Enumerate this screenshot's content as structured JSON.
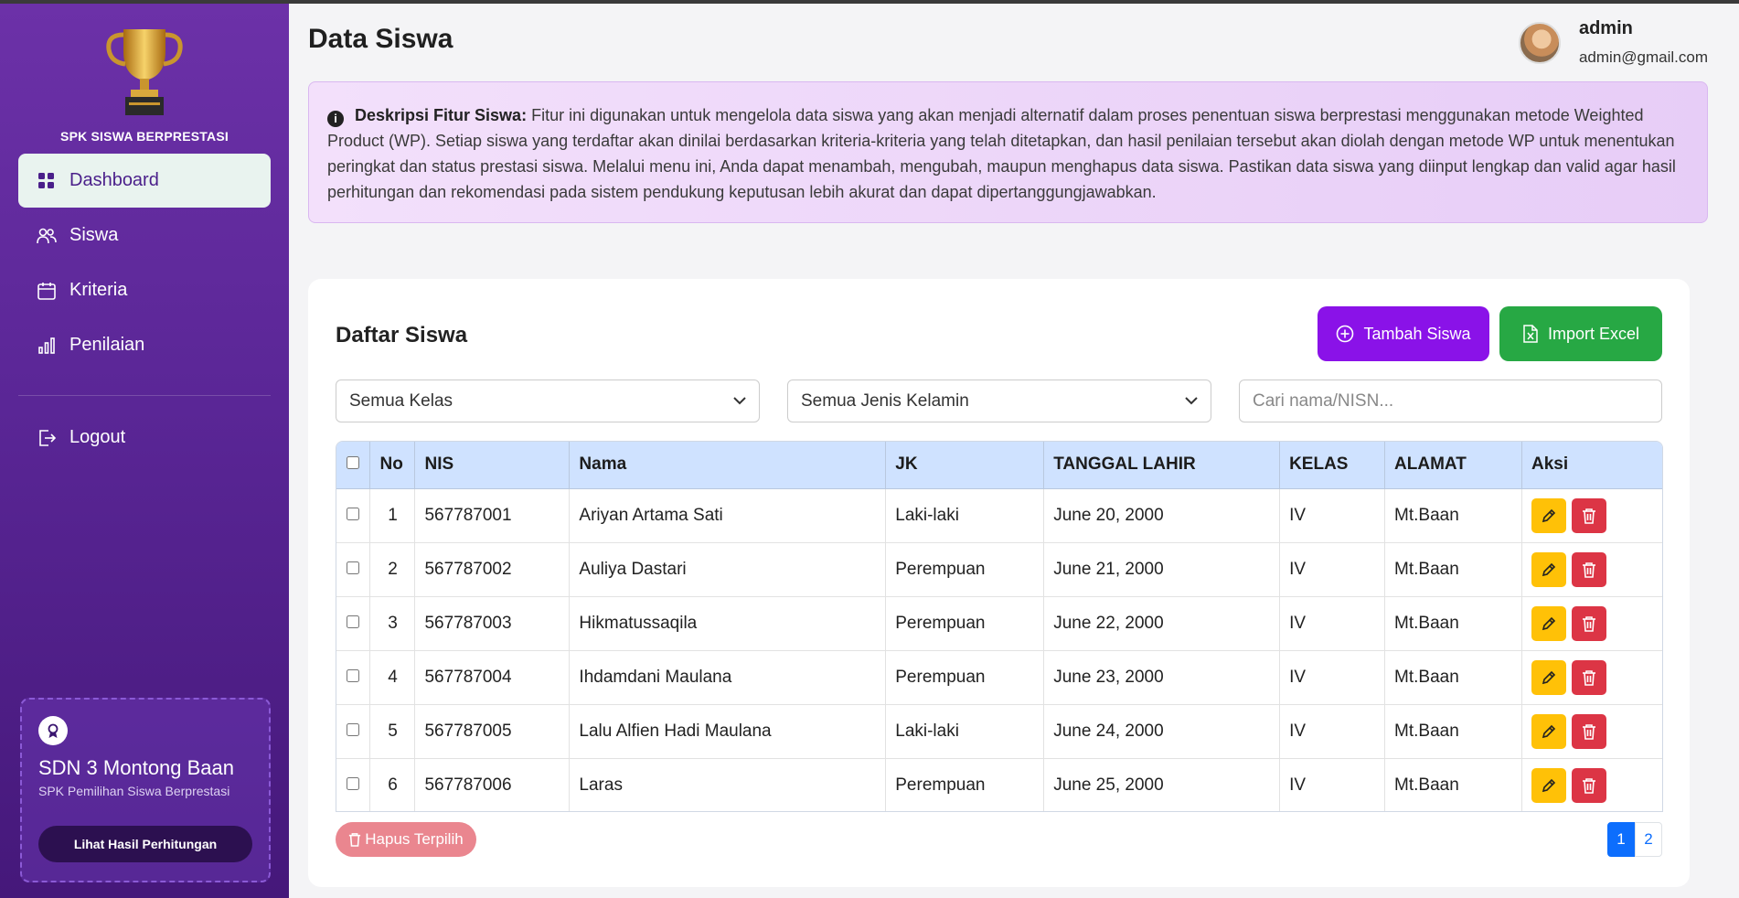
{
  "sidebar": {
    "brand": "SPK SISWA BERPRESTASI",
    "items": [
      {
        "label": "Dashboard"
      },
      {
        "label": "Siswa"
      },
      {
        "label": "Kriteria"
      },
      {
        "label": "Penilaian"
      },
      {
        "label": "Logout"
      }
    ],
    "school": {
      "name": "SDN 3 Montong Baan",
      "subtitle": "SPK Pemilihan Siswa Berprestasi",
      "button_label": "Lihat Hasil Perhitungan"
    }
  },
  "header": {
    "title": "Data Siswa",
    "user_name": "admin",
    "user_email": "admin@gmail.com"
  },
  "info": {
    "label": "Deskripsi Fitur Siswa:",
    "text": "Fitur ini digunakan untuk mengelola data siswa yang akan menjadi alternatif dalam proses penentuan siswa berprestasi menggunakan metode Weighted Product (WP). Setiap siswa yang terdaftar akan dinilai berdasarkan kriteria-kriteria yang telah ditetapkan, dan hasil penilaian tersebut akan diolah dengan metode WP untuk menentukan peringkat dan status prestasi siswa. Melalui menu ini, Anda dapat menambah, mengubah, maupun menghapus data siswa. Pastikan data siswa yang diinput lengkap dan valid agar hasil perhitungan dan rekomendasi pada sistem pendukung keputusan lebih akurat dan dapat dipertanggungjawabkan."
  },
  "card": {
    "title": "Daftar Siswa",
    "add_label": "Tambah Siswa",
    "import_label": "Import Excel",
    "filter_kelas": "Semua Kelas",
    "filter_jk": "Semua Jenis Kelamin",
    "search_placeholder": "Cari nama/NISN...",
    "bulk_delete_label": "Hapus Terpilih"
  },
  "table": {
    "headers": [
      "No",
      "NIS",
      "Nama",
      "JK",
      "TANGGAL LAHIR",
      "KELAS",
      "ALAMAT",
      "Aksi"
    ],
    "rows": [
      {
        "no": "1",
        "nis": "567787001",
        "nama": "Ariyan Artama Sati",
        "jk": "Laki-laki",
        "tgl": "June 20, 2000",
        "kelas": "IV",
        "alamat": "Mt.Baan"
      },
      {
        "no": "2",
        "nis": "567787002",
        "nama": "Auliya Dastari",
        "jk": "Perempuan",
        "tgl": "June 21, 2000",
        "kelas": "IV",
        "alamat": "Mt.Baan"
      },
      {
        "no": "3",
        "nis": "567787003",
        "nama": "Hikmatussaqila",
        "jk": "Perempuan",
        "tgl": "June 22, 2000",
        "kelas": "IV",
        "alamat": "Mt.Baan"
      },
      {
        "no": "4",
        "nis": "567787004",
        "nama": "Ihdamdani Maulana",
        "jk": "Perempuan",
        "tgl": "June 23, 2000",
        "kelas": "IV",
        "alamat": "Mt.Baan"
      },
      {
        "no": "5",
        "nis": "567787005",
        "nama": "Lalu Alfien Hadi Maulana",
        "jk": "Laki-laki",
        "tgl": "June 24, 2000",
        "kelas": "IV",
        "alamat": "Mt.Baan"
      },
      {
        "no": "6",
        "nis": "567787006",
        "nama": "Laras",
        "jk": "Perempuan",
        "tgl": "June 25, 2000",
        "kelas": "IV",
        "alamat": "Mt.Baan"
      }
    ]
  },
  "pagination": {
    "pages": [
      "1",
      "2"
    ],
    "current": "1"
  },
  "colors": {
    "sidebar_top": "#6c31a8",
    "sidebar_bottom": "#45187a",
    "accent_purple": "#8a12e8",
    "accent_green": "#27a844",
    "header_blue": "#cfe2ff",
    "edit_yellow": "#ffc107",
    "delete_red": "#dc3545"
  },
  "icons": {
    "logo": "trophy-icon",
    "dashboard": "grid-icon",
    "siswa": "users-icon",
    "kriteria": "calendar-icon",
    "penilaian": "bar-chart-icon",
    "logout": "logout-icon",
    "school": "award-icon",
    "info": "info-icon",
    "add": "plus-circle-icon",
    "import": "excel-icon",
    "edit": "pencil-icon",
    "delete": "trash-icon",
    "select": "chevron-down-icon"
  }
}
